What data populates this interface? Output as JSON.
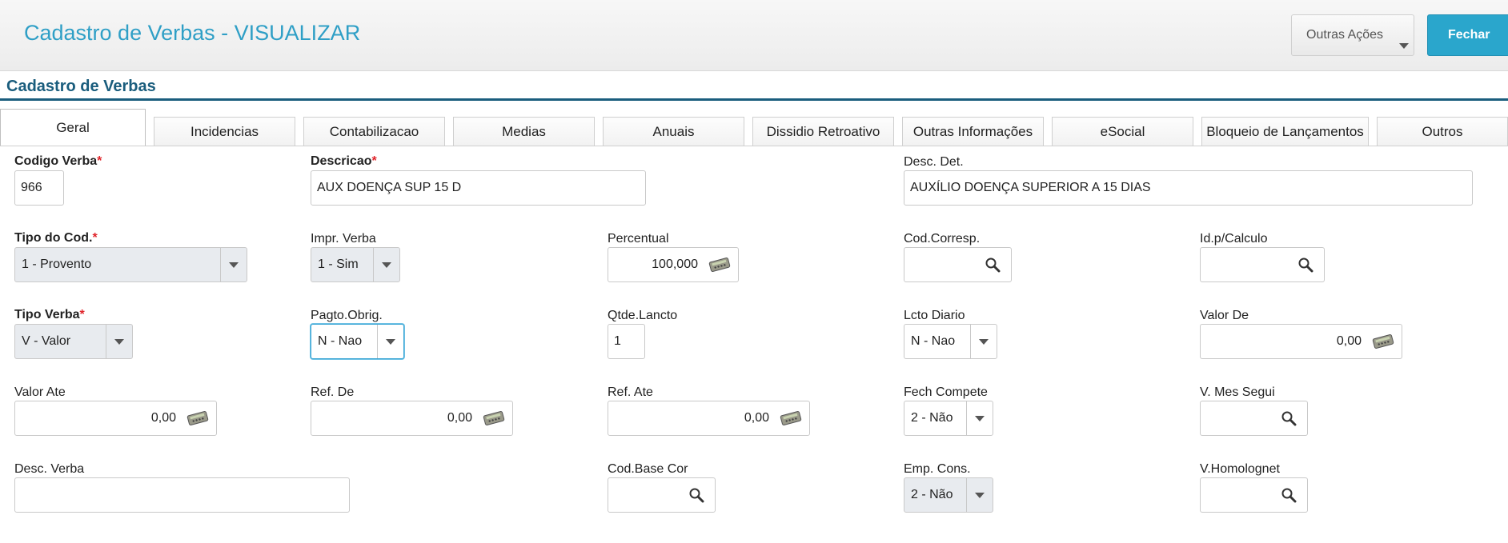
{
  "header": {
    "title": "Cadastro de Verbas - VISUALIZAR",
    "more_actions_label": "Outras Ações",
    "close_label": "Fechar"
  },
  "section": {
    "title": "Cadastro de Verbas"
  },
  "tabs": [
    {
      "label": "Geral",
      "active": true
    },
    {
      "label": "Incidencias"
    },
    {
      "label": "Contabilizacao"
    },
    {
      "label": "Medias"
    },
    {
      "label": "Anuais"
    },
    {
      "label": "Dissidio Retroativo"
    },
    {
      "label": "Outras Informações"
    },
    {
      "label": "eSocial"
    },
    {
      "label": "Bloqueio de Lançamentos"
    },
    {
      "label": "Outros"
    }
  ],
  "fields": {
    "codigo_verba": {
      "label": "Codigo Verba",
      "value": "966"
    },
    "descricao": {
      "label": "Descricao",
      "value": "AUX DOENÇA SUP 15 D"
    },
    "desc_det": {
      "label": "Desc. Det.",
      "value": "AUXÍLIO DOENÇA SUPERIOR A 15 DIAS"
    },
    "tipo_cod": {
      "label": "Tipo do Cod.",
      "value": "1 - Provento"
    },
    "impr_verba": {
      "label": "Impr. Verba",
      "value": "1 - Sim"
    },
    "percentual": {
      "label": "Percentual",
      "value": "100,000"
    },
    "cod_corresp": {
      "label": "Cod.Corresp.",
      "value": ""
    },
    "id_calculo": {
      "label": "Id.p/Calculo",
      "value": ""
    },
    "tipo_verba": {
      "label": "Tipo Verba",
      "value": "V - Valor"
    },
    "pagto_obrig": {
      "label": "Pagto.Obrig.",
      "value": "N - Nao"
    },
    "qtde_lancto": {
      "label": "Qtde.Lancto",
      "value": "1"
    },
    "lcto_diario": {
      "label": "Lcto Diario",
      "value": "N - Nao"
    },
    "valor_de": {
      "label": "Valor De",
      "value": "0,00"
    },
    "valor_ate": {
      "label": "Valor Ate",
      "value": "0,00"
    },
    "ref_de": {
      "label": "Ref. De",
      "value": "0,00"
    },
    "ref_ate": {
      "label": "Ref. Ate",
      "value": "0,00"
    },
    "fech_compete": {
      "label": "Fech Compete",
      "value": "2 - Não"
    },
    "v_mes_segui": {
      "label": "V. Mes Segui",
      "value": ""
    },
    "desc_verba": {
      "label": "Desc. Verba",
      "value": ""
    },
    "cod_base_cor": {
      "label": "Cod.Base Cor",
      "value": ""
    },
    "emp_cons": {
      "label": "Emp. Cons.",
      "value": "2 - Não"
    },
    "v_homolognet": {
      "label": "V.Homolognet",
      "value": ""
    }
  },
  "required_marker": "*",
  "icons": {
    "search": "search-icon",
    "calculator": "calculator-icon",
    "dropdown": "chevron-down-icon"
  },
  "colors": {
    "accent": "#2aa6cc",
    "title": "#2f9fc6",
    "section": "#1a5d7d",
    "required": "#e0242a"
  }
}
